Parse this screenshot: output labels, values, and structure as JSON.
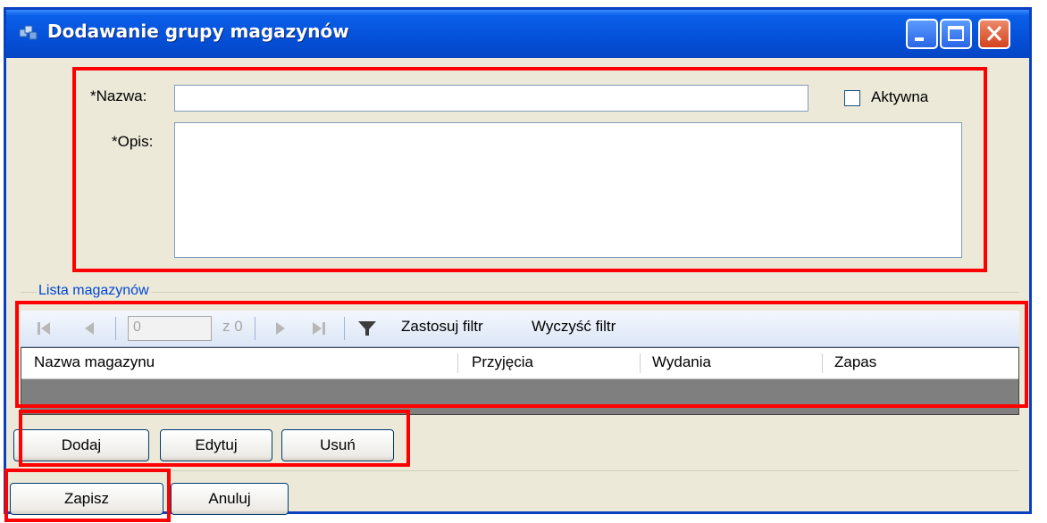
{
  "window": {
    "title": "Dodawanie grupy magazynów"
  },
  "form": {
    "name_label": "*Nazwa:",
    "name_value": "",
    "active_label": "Aktywna",
    "active_checked": false,
    "description_label": "*Opis:",
    "description_value": ""
  },
  "group": {
    "legend": "Lista magazynów"
  },
  "pager": {
    "page_value": "0",
    "of_label": "z 0",
    "apply_filter": "Zastosuj filtr",
    "clear_filter": "Wyczyść filtr"
  },
  "grid": {
    "columns": [
      "Nazwa magazynu",
      "Przyjęcia",
      "Wydania",
      "Zapas"
    ],
    "rows": []
  },
  "actions": {
    "add": "Dodaj",
    "edit": "Edytuj",
    "delete": "Usuń"
  },
  "footer": {
    "save": "Zapisz",
    "cancel": "Anuluj"
  },
  "colors": {
    "title_bar": "#0550d8",
    "highlight": "#ff0000",
    "window_bg": "#ece9d8",
    "legend": "#0046d5"
  },
  "icons": {
    "title": "warehouse-group-icon",
    "pager_first": "first-page-icon",
    "pager_prev": "prev-page-icon",
    "pager_next": "next-page-icon",
    "pager_last": "last-page-icon",
    "filter": "filter-icon"
  }
}
